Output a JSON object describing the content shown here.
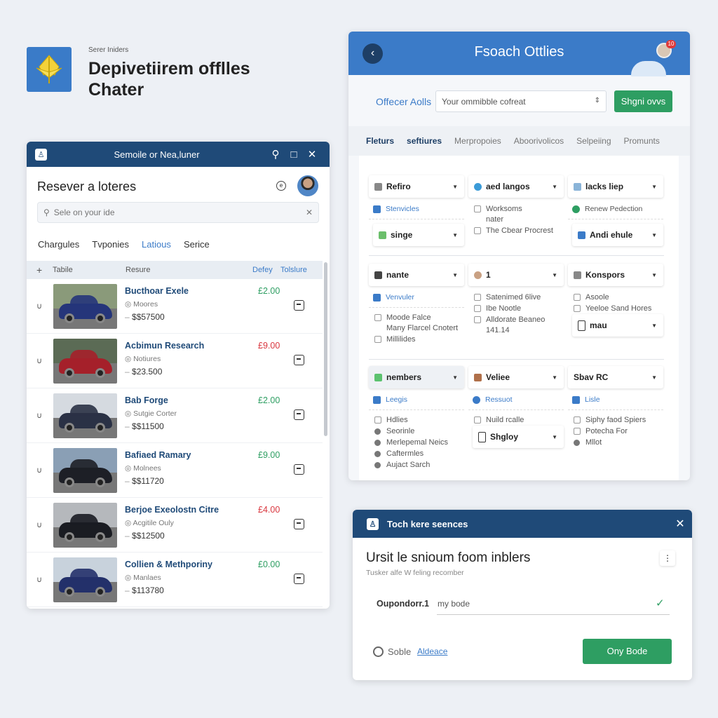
{
  "brand": {
    "subtitle": "Serer Iniders",
    "title": "Depivetiirem offlles Chater",
    "logo_color": "#3a7bc8"
  },
  "left_panel": {
    "window_title": "Semoile or Nea,luner",
    "heading": "Resever a loteres",
    "search": {
      "placeholder": "Sele on your ide"
    },
    "tabs": [
      {
        "label": "Chargules"
      },
      {
        "label": "Tvponies"
      },
      {
        "label": "Latious",
        "active": true
      },
      {
        "label": "Serice"
      }
    ],
    "columns": {
      "add": "+",
      "table": "Tabile",
      "resure": "Resure",
      "delay": "Defey",
      "tolure": "Tolslure"
    },
    "rows": [
      {
        "name": "Bucthoar Exele",
        "sub": "Moores",
        "price": "$$57500",
        "amount": "£2.00",
        "amount_color": "#2e9e62",
        "car_color": "#25357a",
        "bg": "#8a9a7a"
      },
      {
        "name": "Acbimun Research",
        "sub": "Notiures",
        "price": "$23.500",
        "amount": "£9.00",
        "amount_color": "#d9363e",
        "car_color": "#a5202a",
        "bg": "#5b6b55"
      },
      {
        "name": "Bab Forge",
        "sub": "Sutgie Corter",
        "price": "$$11500",
        "amount": "£2.00",
        "amount_color": "#2e9e62",
        "car_color": "#2a3145",
        "bg": "#d5dae0"
      },
      {
        "name": "Bafiaed Ramary",
        "sub": "Molnees",
        "price": "$$11720",
        "amount": "£9.00",
        "amount_color": "#2e9e62",
        "car_color": "#1d1f26",
        "bg": "#8a9fb5"
      },
      {
        "name": "Berjoe Exeolostn Citre",
        "sub": "Acgitile Ouly",
        "price": "$$12500",
        "amount": "£4.00",
        "amount_color": "#d9363e",
        "car_color": "#1a1c22",
        "bg": "#b5b8bc"
      },
      {
        "name": "Collien & Methporiny",
        "sub": "Manlaes",
        "price": "$113780",
        "amount": "£0.00",
        "amount_color": "#2e9e62",
        "car_color": "#23306a",
        "bg": "#c8d2dc"
      }
    ]
  },
  "right_panel": {
    "title": "Fsoach Ottlies",
    "badge": "10",
    "officer_label": "Offecer Aolls",
    "officer_select": "Your ommibble cofreat",
    "sign_button": "Shgni ovvs",
    "tabs": [
      {
        "label": "Fleturs",
        "active": true
      },
      {
        "label": "seftiures",
        "active": true
      },
      {
        "label": "Merpropoies"
      },
      {
        "label": "Aboorivolicos"
      },
      {
        "label": "Selpeiing"
      },
      {
        "label": "Promunts"
      }
    ],
    "filter_rows": [
      [
        [
          {
            "type": "select",
            "icon": "bar",
            "color": "#888",
            "label": "Refiro"
          },
          {
            "type": "link",
            "icon": "checked-box",
            "color": "#3b7bc8",
            "label": "Stenvicles"
          },
          {
            "type": "select",
            "icon": "mail",
            "color": "#6bbf6b",
            "label": "singe",
            "inset": true
          }
        ],
        [
          {
            "type": "select",
            "icon": "globe",
            "color": "#3b9bd8",
            "label": "aed langos"
          },
          {
            "type": "check",
            "label": "Worksoms"
          },
          {
            "type": "note",
            "label": "nater"
          },
          {
            "type": "check",
            "label": "The Cbear Procrest"
          }
        ],
        [
          {
            "type": "select",
            "icon": "person",
            "color": "#8ab4d8",
            "label": "lacks liep"
          },
          {
            "type": "link",
            "icon": "check-circle",
            "color": "#2e9e62",
            "label": "Renew Pedection",
            "gray": true
          },
          {
            "type": "select",
            "icon": "logo",
            "color": "#3b7bc8",
            "label": "Andi ehule",
            "inset": true
          }
        ]
      ],
      [
        [
          {
            "type": "select",
            "icon": "briefcase",
            "color": "#444",
            "label": "nante"
          },
          {
            "type": "link",
            "icon": "checked-box",
            "color": "#3b7bc8",
            "label": "Venvuler"
          },
          {
            "type": "check",
            "label": "Moode Falce"
          },
          {
            "type": "note",
            "label": "Many Flarcel Cnotert"
          },
          {
            "type": "check",
            "label": "Millilides"
          }
        ],
        [
          {
            "type": "select",
            "icon": "avatar",
            "color": "#c9a183",
            "label": "1"
          },
          {
            "type": "check",
            "label": "Satenimed 6live"
          },
          {
            "type": "check",
            "label": "Ibe Nootle"
          },
          {
            "type": "check",
            "label": "Alldorate Beaneo"
          },
          {
            "type": "note",
            "label": "141.14"
          }
        ],
        [
          {
            "type": "select",
            "icon": "chat",
            "color": "#888",
            "label": "Konspors"
          },
          {
            "type": "check",
            "label": "Asoole"
          },
          {
            "type": "check",
            "label": "Yeeloe Sand Hores"
          },
          {
            "type": "select",
            "icon": "box",
            "color": "#fff",
            "label": "mau",
            "inset": true
          }
        ]
      ],
      [
        [
          {
            "type": "select",
            "icon": "members",
            "color": "#5cc26f",
            "label": "nembers",
            "highlight": true
          },
          {
            "type": "link",
            "icon": "tree",
            "color": "#3b7bc8",
            "label": "Leegis"
          },
          {
            "type": "check",
            "label": "Hdlies"
          },
          {
            "type": "bullet",
            "label": "Seorinle"
          },
          {
            "type": "bullet",
            "label": "Merlepemal Neics"
          },
          {
            "type": "bullet",
            "label": "Caftermles"
          },
          {
            "type": "bullet",
            "label": "Aujact Sarch"
          }
        ],
        [
          {
            "type": "select",
            "icon": "coffee",
            "color": "#b0704a",
            "label": "Veliee"
          },
          {
            "type": "link",
            "icon": "info-circle",
            "color": "#3b7bc8",
            "label": "Ressuot"
          },
          {
            "type": "check",
            "label": "Nuild rcalle"
          },
          {
            "type": "select",
            "icon": "box",
            "color": "#fff",
            "label": "Shgloy",
            "inset": true
          }
        ],
        [
          {
            "type": "select",
            "icon": "",
            "color": "",
            "label": "Sbav RC"
          },
          {
            "type": "link",
            "icon": "checked-box",
            "color": "#3b7bc8",
            "label": "Lisle"
          },
          {
            "type": "check",
            "label": "Siphy faod Spiers"
          },
          {
            "type": "check",
            "label": "Potecha For"
          },
          {
            "type": "bullet",
            "label": "Mllot"
          }
        ]
      ]
    ]
  },
  "dialog": {
    "title": "Toch kere seences",
    "heading": "Ursit le snioum foom inblers",
    "subheading": "Tusker alfe W feling recomber",
    "field_label": "Oupondorr.1",
    "field_value": "my bode",
    "radio_label": "Soble",
    "link": "Aldeace",
    "button": "Ony Bode"
  },
  "colors": {
    "navy": "#1f4a78",
    "blue": "#3b7bc8",
    "green": "#2e9e62",
    "red": "#d9363e"
  }
}
